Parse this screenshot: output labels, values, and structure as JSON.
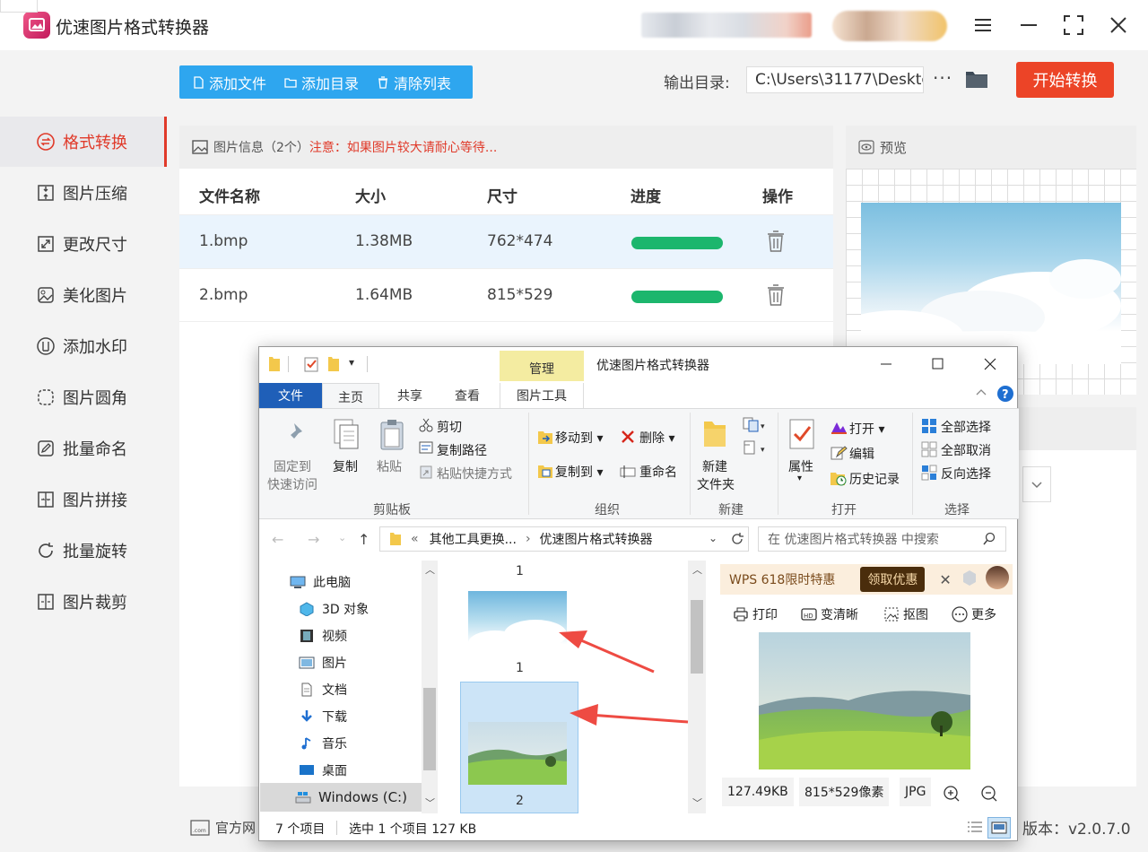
{
  "app": {
    "title": "优速图片格式转换器"
  },
  "sidebar": {
    "items": [
      {
        "label": "格式转换",
        "icon": "convert-icon"
      },
      {
        "label": "图片压缩",
        "icon": "compress-icon"
      },
      {
        "label": "更改尺寸",
        "icon": "resize-icon"
      },
      {
        "label": "美化图片",
        "icon": "beautify-icon"
      },
      {
        "label": "添加水印",
        "icon": "watermark-icon"
      },
      {
        "label": "图片圆角",
        "icon": "round-corner-icon"
      },
      {
        "label": "批量命名",
        "icon": "rename-icon"
      },
      {
        "label": "图片拼接",
        "icon": "join-icon"
      },
      {
        "label": "批量旋转",
        "icon": "rotate-icon"
      },
      {
        "label": "图片裁剪",
        "icon": "crop-icon"
      }
    ]
  },
  "toolbar": {
    "add_file": "添加文件",
    "add_dir": "添加目录",
    "clear_list": "清除列表",
    "output_label": "输出目录:",
    "output_path": "C:\\Users\\31177\\Deskto",
    "more": "···",
    "start": "开始转换"
  },
  "panel": {
    "info": "图片信息（2个）",
    "warning": "注意：如果图片较大请耐心等待...",
    "columns": [
      "文件名称",
      "大小",
      "尺寸",
      "进度",
      "操作"
    ],
    "rows": [
      {
        "name": "1.bmp",
        "size": "1.38MB",
        "dims": "762*474",
        "progress": 1.0
      },
      {
        "name": "2.bmp",
        "size": "1.64MB",
        "dims": "815*529",
        "progress": 1.0
      }
    ]
  },
  "preview": {
    "title": "预览"
  },
  "footer": {
    "website": "官方网",
    "version": "版本：v2.0.7.0"
  },
  "explorer": {
    "title": "优速图片格式转换器",
    "manage_tab": "管理",
    "tabs": [
      "文件",
      "主页",
      "共享",
      "查看",
      "图片工具"
    ],
    "ribbon": {
      "pin": "固定到\n快速访问",
      "pin_1": "固定到",
      "pin_2": "快速访问",
      "copy": "复制",
      "paste": "粘贴",
      "cut": "剪切",
      "copy_path": "复制路径",
      "paste_shortcut": "粘贴快捷方式",
      "clipboard": "剪贴板",
      "move_to": "移动到",
      "copy_to": "复制到",
      "delete": "删除",
      "rename": "重命名",
      "organize": "组织",
      "new_folder_1": "新建",
      "new_folder_2": "文件夹",
      "new": "新建",
      "properties": "属性",
      "open": "打开",
      "edit": "编辑",
      "history": "历史记录",
      "open_group": "打开",
      "select_all": "全部选择",
      "select_none": "全部取消",
      "invert": "反向选择",
      "select_group": "选择"
    },
    "address": {
      "prefix": "«",
      "parent": "其他工具更换...",
      "sep": "›",
      "current": "优速图片格式转换器"
    },
    "search_placeholder": "在 优速图片格式转换器 中搜索",
    "nav": [
      "此电脑",
      "3D 对象",
      "视频",
      "图片",
      "文档",
      "下载",
      "音乐",
      "桌面",
      "Windows (C:)"
    ],
    "files": [
      {
        "top_label": "1",
        "label": "1"
      },
      {
        "label": "2"
      }
    ],
    "ad": {
      "text": "WPS 618限时特惠",
      "button": "领取优惠"
    },
    "preview_actions": [
      "打印",
      "变清晰",
      "抠图",
      "更多"
    ],
    "preview_meta": [
      "127.49KB",
      "815*529像素",
      "JPG"
    ],
    "status": {
      "count": "7 个项目",
      "selected": "选中 1 个项目  127 KB"
    }
  },
  "colors": {
    "accent": "#e03a2a",
    "toolbar_blue": "#2ea6ef",
    "start_btn": "#ec4427",
    "progress": "#1cb66d"
  }
}
